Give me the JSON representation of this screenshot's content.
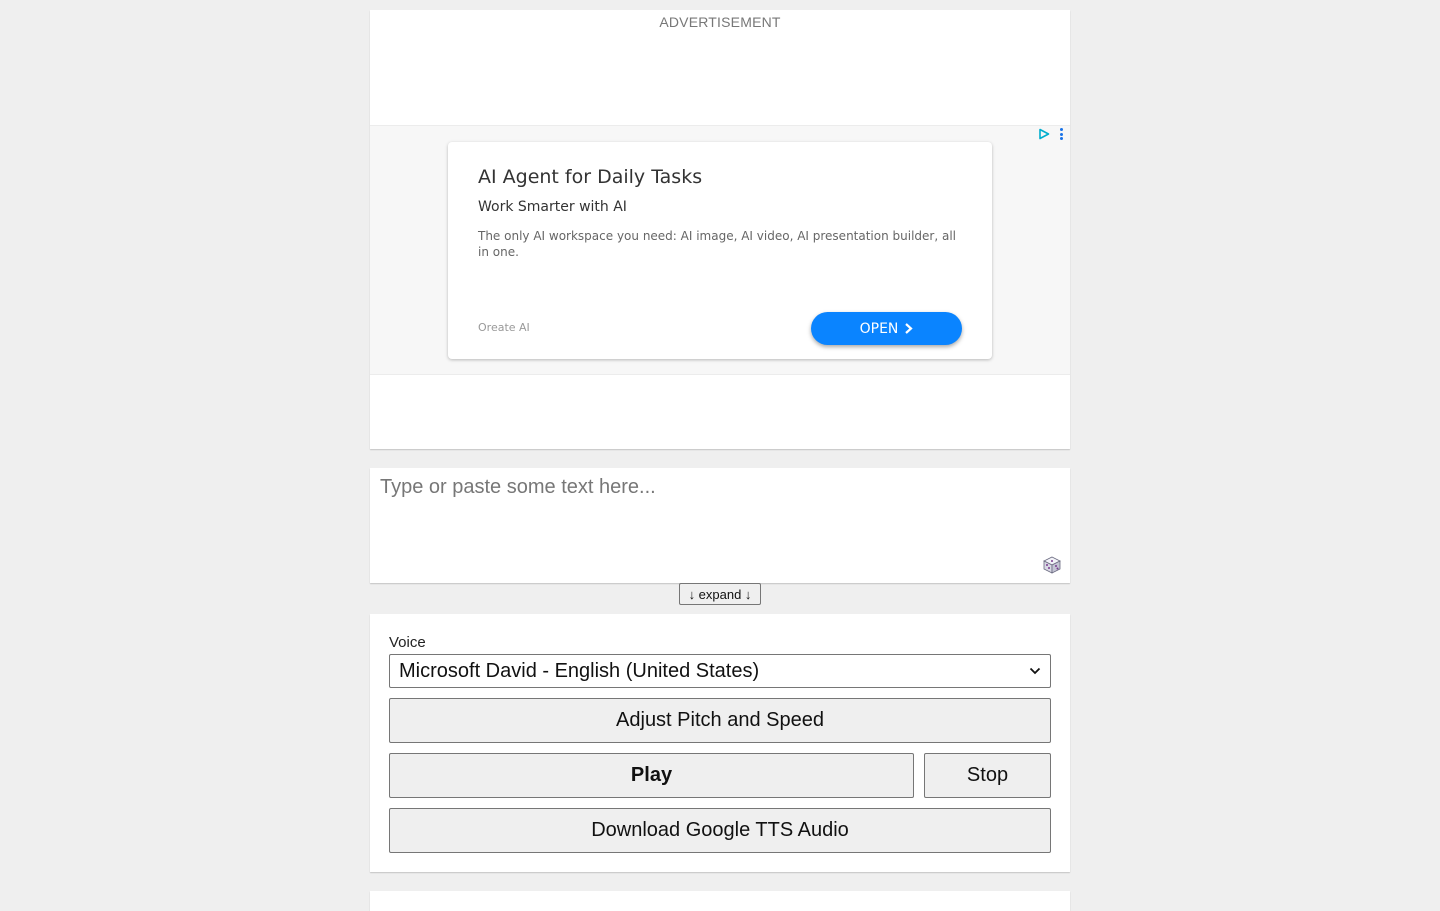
{
  "ad": {
    "label": "ADVERTISEMENT",
    "title": "AI Agent for Daily Tasks",
    "subtitle": "Work Smarter with AI",
    "description": "The only AI workspace you need: AI image, AI video, AI presentation builder, all in one.",
    "brand": "Oreate AI",
    "cta": "OPEN",
    "cta_color": "#0a84ff",
    "icons": [
      "adchoices-icon",
      "ad-menu-icon",
      "chevron-right-icon"
    ]
  },
  "editor": {
    "placeholder": "Type or paste some text here...",
    "value": "",
    "random_icon": "dice-icon",
    "expand_label": "↓ expand ↓"
  },
  "controls": {
    "voice_label": "Voice",
    "voice_selected": "Microsoft David - English (United States)",
    "pitch_speed_label": "Adjust Pitch and Speed",
    "play_label": "Play",
    "stop_label": "Stop",
    "download_label": "Download Google TTS Audio"
  }
}
